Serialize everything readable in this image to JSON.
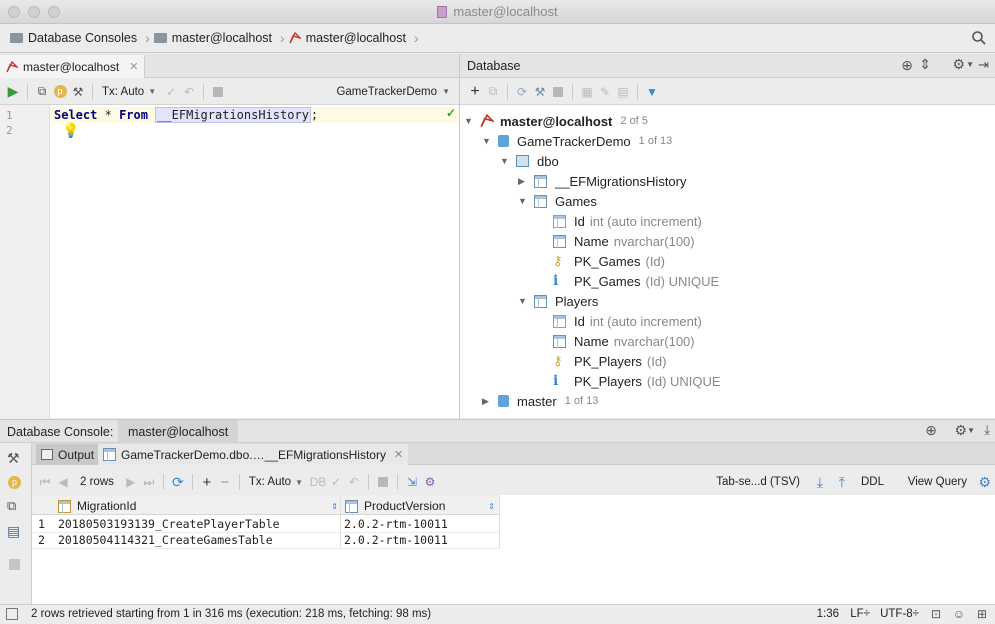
{
  "window": {
    "title": "master@localhost"
  },
  "breadcrumb": {
    "items": [
      "Database Consoles",
      "master@localhost",
      "master@localhost"
    ]
  },
  "editor": {
    "tab_label": "master@localhost",
    "tx_mode": "Tx: Auto",
    "schema": "GameTrackerDemo",
    "lines": [
      "1",
      "2"
    ],
    "code_keyword1": "Select",
    "code_op": "*",
    "code_keyword2": "From",
    "code_table": "__EFMigrationsHistory",
    "code_end": ";"
  },
  "database": {
    "title": "Database",
    "tree": [
      {
        "label": "master@localhost",
        "count": "2 of 5"
      },
      {
        "label": "GameTrackerDemo",
        "count": "1 of 13"
      },
      {
        "label": "dbo"
      },
      {
        "label": "__EFMigrationsHistory"
      },
      {
        "label": "Games"
      },
      {
        "label": "Id",
        "detail": "int (auto increment)"
      },
      {
        "label": "Name",
        "detail": "nvarchar(100)"
      },
      {
        "label": "PK_Games",
        "detail": "(Id)"
      },
      {
        "label": "PK_Games",
        "detail": "(Id) UNIQUE"
      },
      {
        "label": "Players"
      },
      {
        "label": "Id",
        "detail": "int (auto increment)"
      },
      {
        "label": "Name",
        "detail": "nvarchar(100)"
      },
      {
        "label": "PK_Players",
        "detail": "(Id)"
      },
      {
        "label": "PK_Players",
        "detail": "(Id) UNIQUE"
      },
      {
        "label": "master",
        "count": "1 of 13"
      }
    ]
  },
  "console": {
    "label": "Database Console:",
    "tab": "master@localhost",
    "output_tab": "Output",
    "result_tab": "GameTrackerDemo.dbo.…__EFMigrationsHistory",
    "rows_label": "2 rows",
    "tx_mode": "Tx: Auto",
    "export_format": "Tab-se...d (TSV)",
    "ddl": "DDL",
    "view_query": "View Query",
    "columns": [
      "MigrationId",
      "ProductVersion"
    ],
    "rows": [
      {
        "n": "1",
        "c1": "20180503193139_CreatePlayerTable",
        "c2": "2.0.2-rtm-10011"
      },
      {
        "n": "2",
        "c1": "20180504114321_CreateGamesTable",
        "c2": "2.0.2-rtm-10011"
      }
    ]
  },
  "status": {
    "message": "2 rows retrieved starting from 1 in 316 ms (execution: 218 ms, fetching: 98 ms)",
    "position": "1:36",
    "line_sep": "LF÷",
    "encoding": "UTF-8÷"
  },
  "colors": {
    "accent_blue": "#4a90d9",
    "keyword": "#000080",
    "run_green": "#3a9a3a",
    "key_gold": "#d9a321"
  }
}
